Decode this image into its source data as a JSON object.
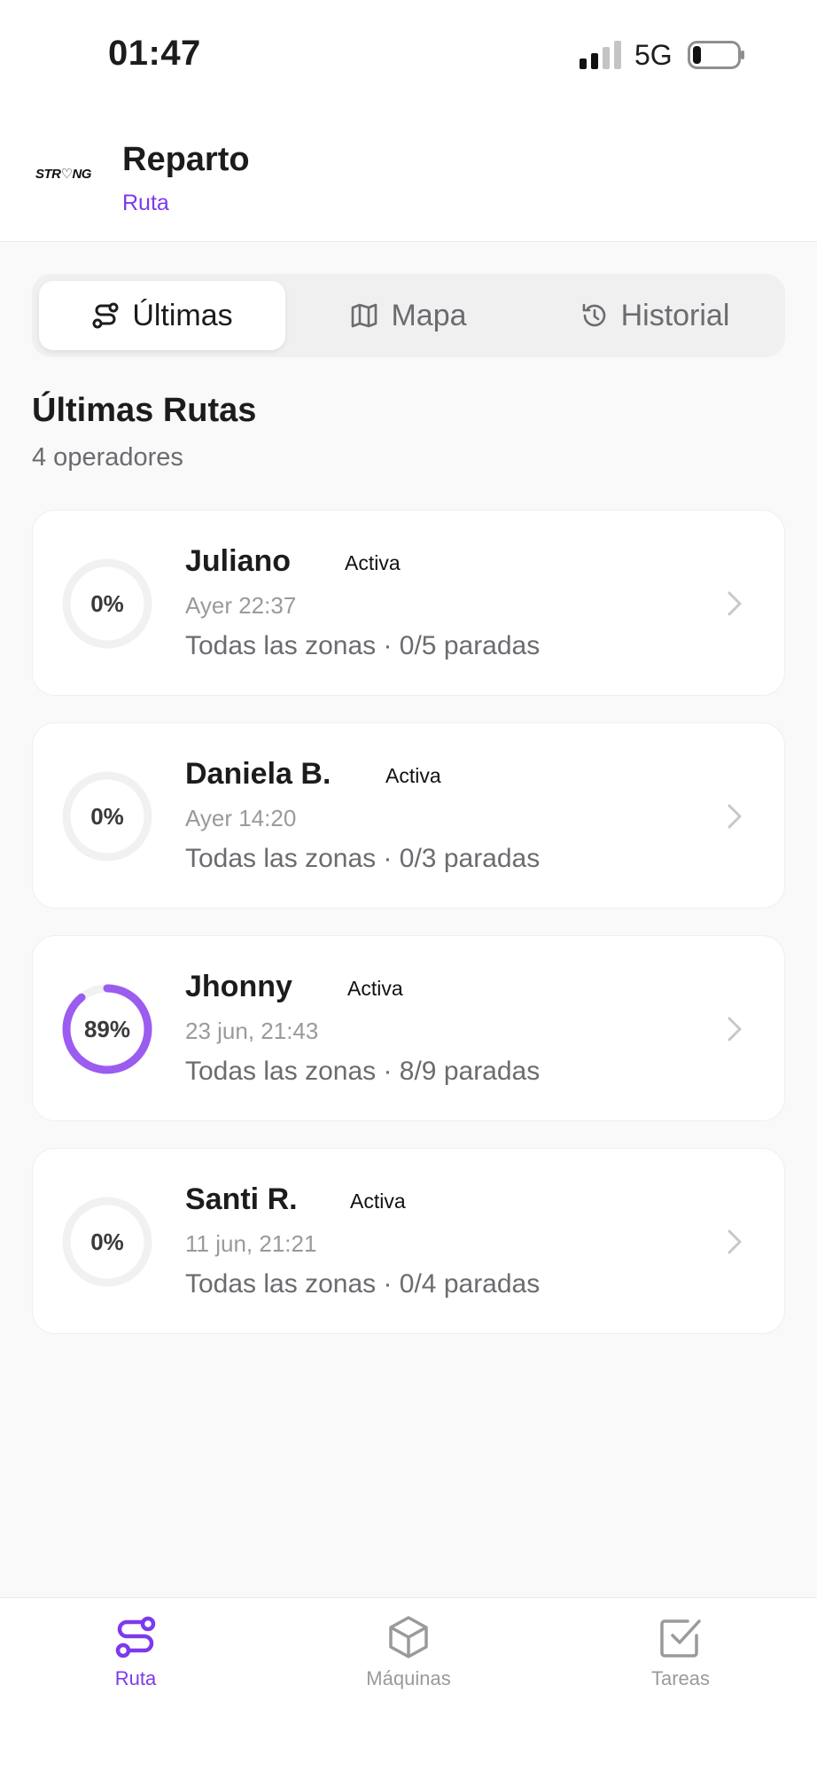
{
  "status_bar": {
    "time": "01:47",
    "network": "5G",
    "signal_icon": "signal-bars-icon",
    "battery_icon": "battery-low-icon"
  },
  "header": {
    "logo": "STR♡NG",
    "title": "Reparto",
    "subtitle": "Ruta"
  },
  "tabs": [
    {
      "label": "Últimas",
      "icon": "route-icon",
      "active": true
    },
    {
      "label": "Mapa",
      "icon": "map-icon",
      "active": false
    },
    {
      "label": "Historial",
      "icon": "history-icon",
      "active": false
    }
  ],
  "section": {
    "title": "Últimas Rutas",
    "subtitle": "4 operadores"
  },
  "routes": [
    {
      "name": "Juliano",
      "status": "Activa",
      "time": "Ayer 22:37",
      "detail": "Todas las zonas · 0/5 paradas",
      "progress_label": "0%",
      "progress": 0
    },
    {
      "name": "Daniela B.",
      "status": "Activa",
      "time": "Ayer 14:20",
      "detail": "Todas las zonas · 0/3 paradas",
      "progress_label": "0%",
      "progress": 0
    },
    {
      "name": "Jhonny",
      "status": "Activa",
      "time": "23 jun, 21:43",
      "detail": "Todas las zonas · 8/9 paradas",
      "progress_label": "89%",
      "progress": 0.89
    },
    {
      "name": "Santi R.",
      "status": "Activa",
      "time": "11 jun, 21:21",
      "detail": "Todas las zonas · 0/4 paradas",
      "progress_label": "0%",
      "progress": 0
    }
  ],
  "bottom_nav": [
    {
      "label": "Ruta",
      "icon": "route-icon",
      "active": true
    },
    {
      "label": "Máquinas",
      "icon": "box-icon",
      "active": false
    },
    {
      "label": "Tareas",
      "icon": "checkbox-icon",
      "active": false
    }
  ],
  "colors": {
    "accent": "#7c3aed",
    "ring_progress": "#9b5cf0",
    "ring_track": "#f1f1f2"
  }
}
